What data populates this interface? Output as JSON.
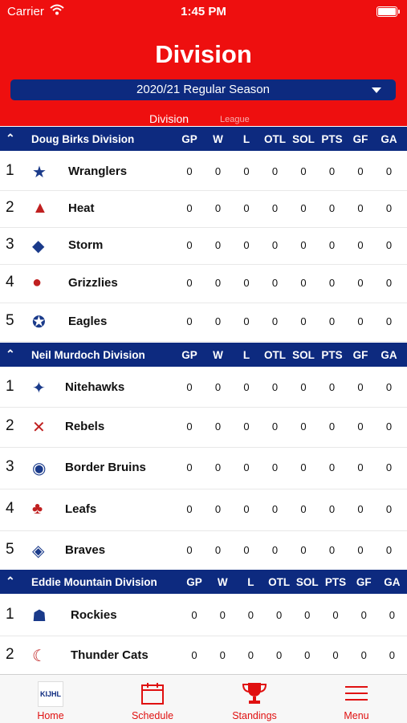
{
  "status": {
    "carrier": "Carrier",
    "time": "1:45 PM"
  },
  "header": {
    "title": "Division",
    "season": "2020/21 Regular Season"
  },
  "segments": {
    "division": "Division",
    "league": "League"
  },
  "columns": [
    "GP",
    "W",
    "L",
    "OTL",
    "SOL",
    "PTS",
    "GF",
    "GA"
  ],
  "divisions": [
    {
      "name": "Doug Birks Division",
      "teams": [
        {
          "rank": "1",
          "name": "Wranglers",
          "stats": [
            "0",
            "0",
            "0",
            "0",
            "0",
            "0",
            "0",
            "0"
          ]
        },
        {
          "rank": "2",
          "name": "Heat",
          "stats": [
            "0",
            "0",
            "0",
            "0",
            "0",
            "0",
            "0",
            "0"
          ]
        },
        {
          "rank": "3",
          "name": "Storm",
          "stats": [
            "0",
            "0",
            "0",
            "0",
            "0",
            "0",
            "0",
            "0"
          ]
        },
        {
          "rank": "4",
          "name": "Grizzlies",
          "stats": [
            "0",
            "0",
            "0",
            "0",
            "0",
            "0",
            "0",
            "0"
          ]
        },
        {
          "rank": "5",
          "name": "Eagles",
          "stats": [
            "0",
            "0",
            "0",
            "0",
            "0",
            "0",
            "0",
            "0"
          ]
        }
      ]
    },
    {
      "name": "Neil Murdoch Division",
      "teams": [
        {
          "rank": "1",
          "name": "Nitehawks",
          "stats": [
            "0",
            "0",
            "0",
            "0",
            "0",
            "0",
            "0",
            "0"
          ]
        },
        {
          "rank": "2",
          "name": "Rebels",
          "stats": [
            "0",
            "0",
            "0",
            "0",
            "0",
            "0",
            "0",
            "0"
          ]
        },
        {
          "rank": "3",
          "name": "Border Bruins",
          "stats": [
            "0",
            "0",
            "0",
            "0",
            "0",
            "0",
            "0",
            "0"
          ]
        },
        {
          "rank": "4",
          "name": "Leafs",
          "stats": [
            "0",
            "0",
            "0",
            "0",
            "0",
            "0",
            "0",
            "0"
          ]
        },
        {
          "rank": "5",
          "name": "Braves",
          "stats": [
            "0",
            "0",
            "0",
            "0",
            "0",
            "0",
            "0",
            "0"
          ]
        }
      ]
    },
    {
      "name": "Eddie Mountain Division",
      "teams": [
        {
          "rank": "1",
          "name": "Rockies",
          "stats": [
            "0",
            "0",
            "0",
            "0",
            "0",
            "0",
            "0",
            "0"
          ]
        },
        {
          "rank": "2",
          "name": "Thunder Cats",
          "stats": [
            "0",
            "0",
            "0",
            "0",
            "0",
            "0",
            "0",
            "0"
          ]
        }
      ]
    }
  ],
  "tabbar": {
    "home": "Home",
    "schedule": "Schedule",
    "standings": "Standings",
    "menu": "Menu",
    "home_logo_text": "KIJHL"
  },
  "colors": {
    "red": "#ee0f0f",
    "navy": "#0d2a7f"
  }
}
